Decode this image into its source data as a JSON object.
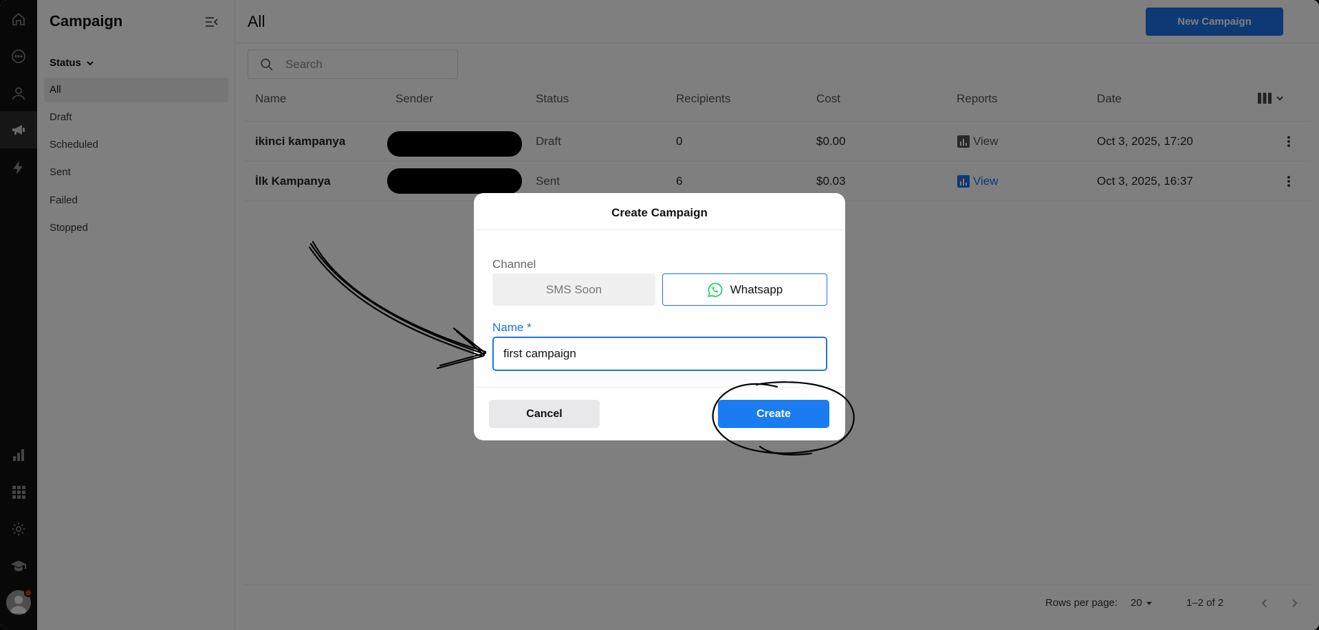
{
  "app": {
    "rail": {
      "icons": [
        "home-icon",
        "chat-icon",
        "contacts-icon",
        "megaphone-icon",
        "lightning-icon",
        "bar-chart-icon",
        "apps-grid-icon",
        "gear-icon",
        "graduation-cap-icon",
        "avatar"
      ]
    },
    "sidebar": {
      "title": "Campaign",
      "status_label": "Status",
      "filters": [
        {
          "label": "All",
          "active": true
        },
        {
          "label": "Draft"
        },
        {
          "label": "Scheduled"
        },
        {
          "label": "Sent"
        },
        {
          "label": "Failed"
        },
        {
          "label": "Stopped"
        }
      ]
    },
    "header": {
      "title": "All",
      "new_button": "New Campaign"
    },
    "search": {
      "placeholder": "Search"
    },
    "table": {
      "columns": [
        "Name",
        "Sender",
        "Status",
        "Recipients",
        "Cost",
        "Reports",
        "Date"
      ],
      "rows": [
        {
          "name": "ikinci kampanya",
          "status": "Draft",
          "recipients": "0",
          "cost": "$0.00",
          "report": "View",
          "date": "Oct 3, 2025, 17:20"
        },
        {
          "name": "İlk Kampanya",
          "status": "Sent",
          "recipients": "6",
          "cost": "$0.03",
          "report": "View",
          "date": "Oct 3, 2025, 16:37"
        }
      ]
    },
    "pagination": {
      "rows_per_page_label": "Rows per page:",
      "rows_per_page": "20",
      "range": "1–2 of 2"
    },
    "modal": {
      "title": "Create Campaign",
      "channel_label": "Channel",
      "sms_option": "SMS Soon",
      "whatsapp_option": "Whatsapp",
      "name_label": "Name *",
      "name_value": "first campaign",
      "cancel": "Cancel",
      "create": "Create"
    },
    "colors": {
      "accent": "#1a73e8",
      "whatsapp": "#25d366",
      "rail": "#111111"
    }
  }
}
